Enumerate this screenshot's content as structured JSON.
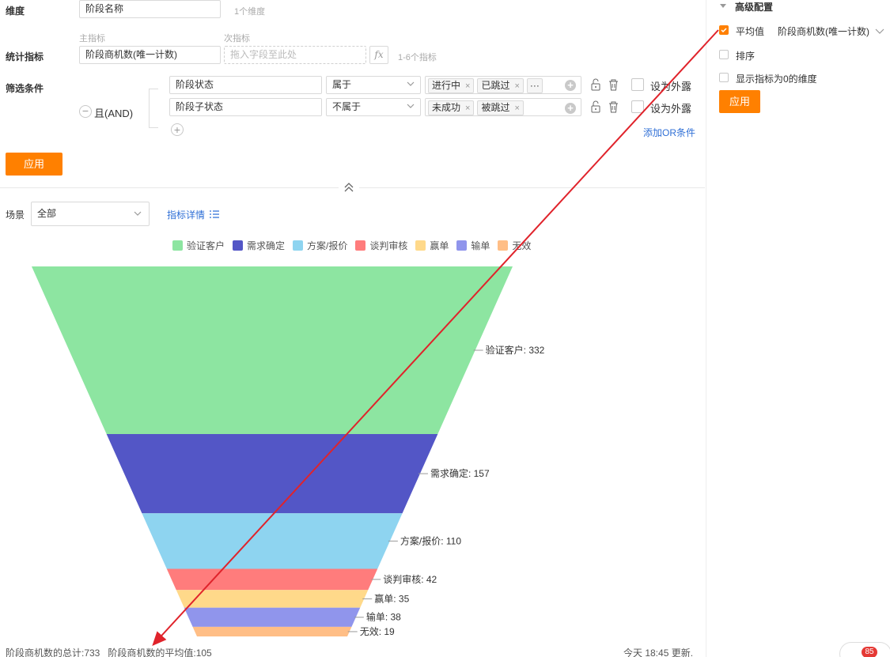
{
  "form": {
    "dimension_label": "维度",
    "dimension_value": "阶段名称",
    "dimension_hint": "1个维度",
    "main_metric_caption": "主指标",
    "sub_metric_caption": "次指标",
    "metric_label": "统计指标",
    "metric_value": "阶段商机数(唯一计数)",
    "metric_drop_placeholder": "拖入字段至此处",
    "fx_label": "fx",
    "metric_hint": "1-6个指标",
    "filter_label": "筛选条件",
    "logic_label": "且(AND)",
    "filters": [
      {
        "field": "阶段状态",
        "op": "属于",
        "tags": [
          "进行中",
          "已跳过"
        ],
        "more": "···",
        "expose_label": "设为外露"
      },
      {
        "field": "阶段子状态",
        "op": "不属于",
        "tags": [
          "未成功",
          "被跳过"
        ],
        "expose_label": "设为外露"
      }
    ],
    "add_or_label": "添加OR条件",
    "apply_label": "应用"
  },
  "toolbar": {
    "scene_label": "场景",
    "scene_value": "全部",
    "metric_detail_label": "指标详情"
  },
  "chart_data": {
    "type": "funnel",
    "categories": [
      "验证客户",
      "需求确定",
      "方案/报价",
      "谈判审核",
      "赢单",
      "输单",
      "无效"
    ],
    "values": [
      332,
      157,
      110,
      42,
      35,
      38,
      19
    ],
    "colors": [
      "#8de5a1",
      "#5356c6",
      "#8ed4f0",
      "#ff7c7c",
      "#ffd98a",
      "#9095ec",
      "#ffbe86"
    ],
    "labels": [
      "验证客户: 332",
      "需求确定: 157",
      "方案/报价: 110",
      "谈判审核: 42",
      "赢单: 35",
      "输单: 38",
      "无效: 19"
    ],
    "legend_position": "top"
  },
  "footer": {
    "summary": "阶段商机数的总计:733   阶段商机数的平均值:105",
    "updated": "今天 18:45 更新."
  },
  "advanced": {
    "title": "高级配置",
    "avg_label": "平均值",
    "avg_field": "阶段商机数(唯一计数)",
    "sort_label": "排序",
    "show_zero_label": "显示指标为0的维度",
    "apply_label": "应用",
    "badge": "85"
  }
}
